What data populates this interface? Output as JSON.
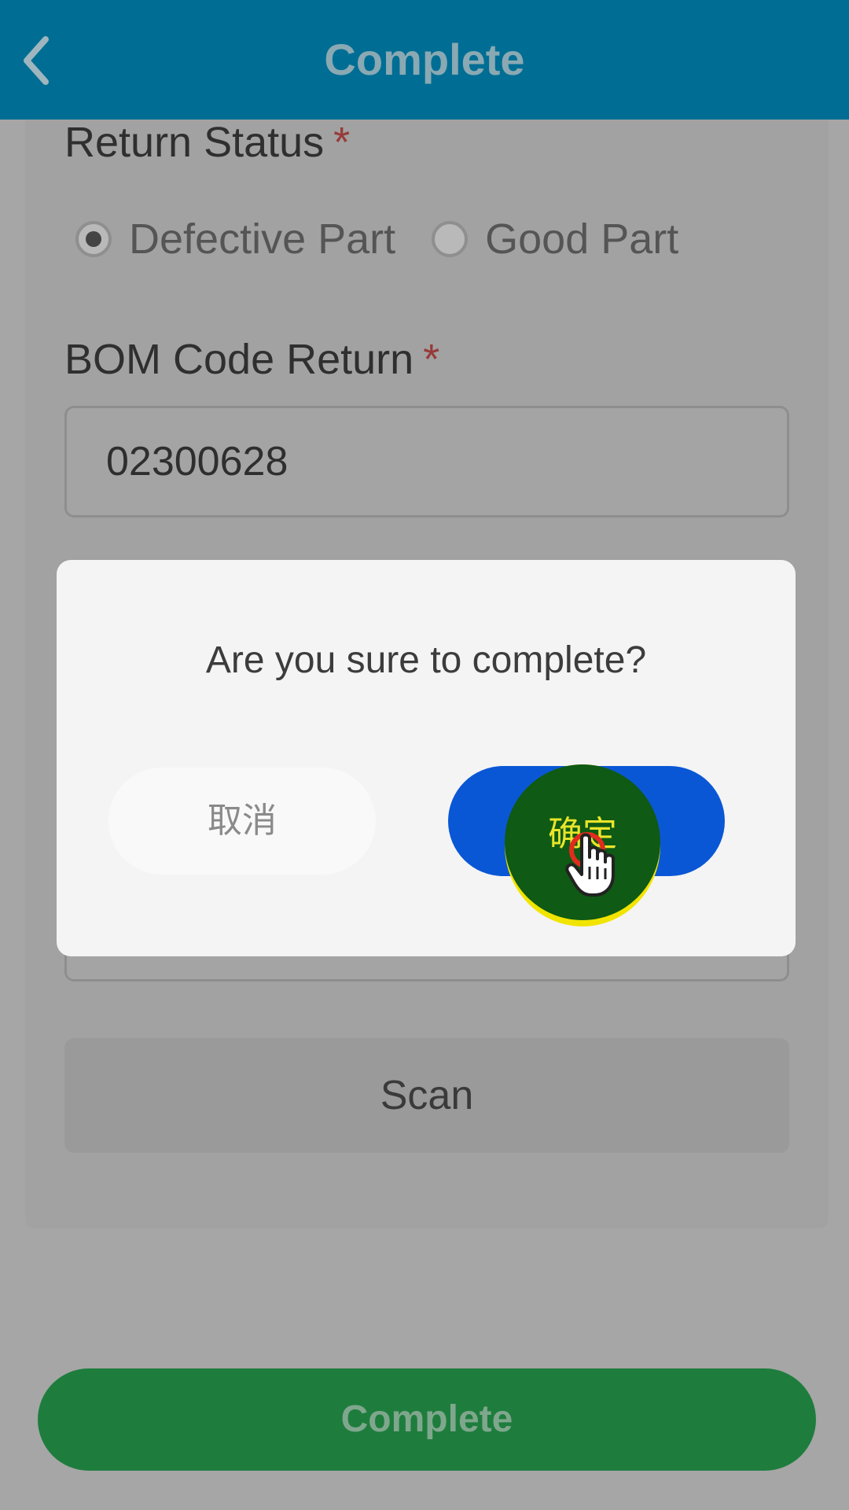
{
  "header": {
    "title": "Complete",
    "back_icon": "chevron-left-icon"
  },
  "form": {
    "return_status": {
      "label": "Return Status",
      "required_mark": "*",
      "options": [
        {
          "label": "Defective Part",
          "selected": true
        },
        {
          "label": "Good Part",
          "selected": false
        }
      ]
    },
    "bom_code_return": {
      "label": "BOM Code Return",
      "required_mark": "*",
      "value": "02300628"
    },
    "scan_label": "Scan"
  },
  "footer": {
    "complete_label": "Complete"
  },
  "dialog": {
    "message": "Are you sure to complete?",
    "cancel_label": "取消",
    "confirm_label": "确定"
  },
  "colors": {
    "header_bg": "#006e94",
    "confirm_bg": "#0a57d6",
    "complete_bg": "#1e7d3d",
    "required": "#983a3a"
  }
}
